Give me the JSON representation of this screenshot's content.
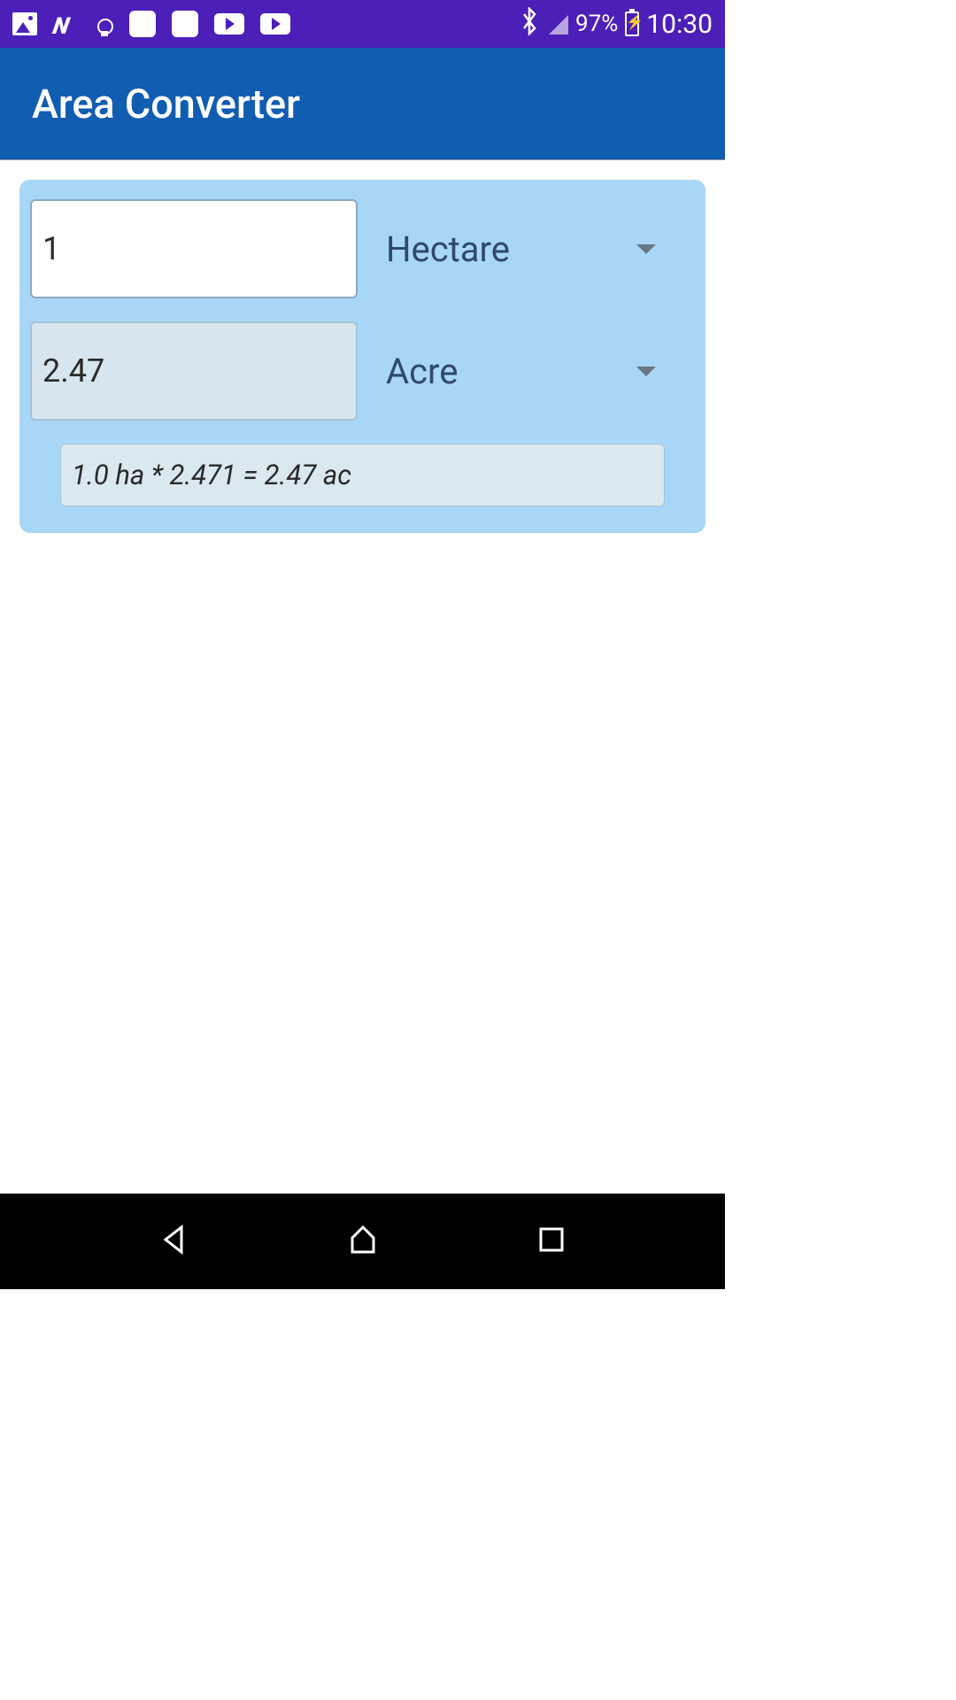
{
  "status_bar": {
    "battery_pct": "97%",
    "time": "10:30"
  },
  "app_bar": {
    "title": "Area Converter"
  },
  "converter": {
    "input_value": "1",
    "input_unit": "Hectare",
    "output_value": "2.47",
    "output_unit": "Acre",
    "formula": "1.0 ha * 2.471 = 2.47 ac"
  },
  "colors": {
    "status_bg": "#4c1fb8",
    "app_bar_bg": "#115db1",
    "card_bg": "#a8d6f7"
  }
}
